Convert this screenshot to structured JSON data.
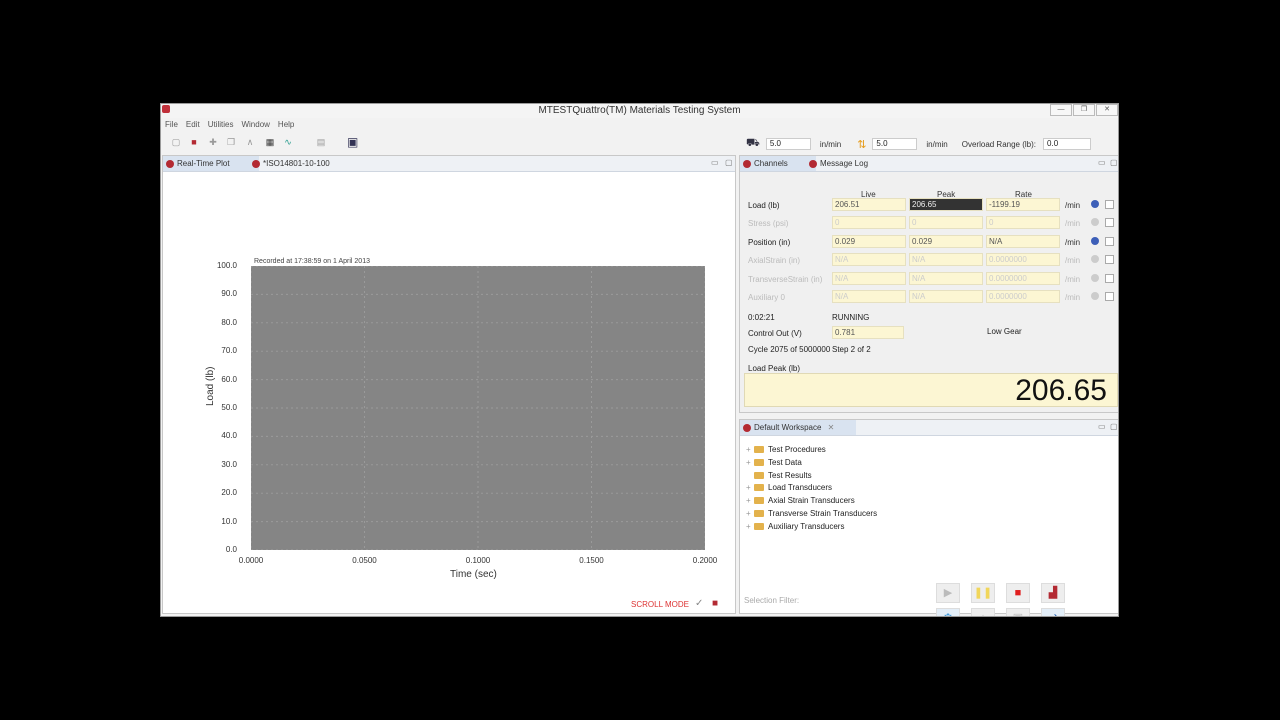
{
  "window": {
    "title": "MTESTQuattro(TM) Materials Testing System",
    "controls": [
      "—",
      "❐",
      "✕"
    ]
  },
  "menu": [
    "File",
    "Edit",
    "Utilities",
    "Window",
    "Help"
  ],
  "speed": {
    "value1": "5.0",
    "unit1": "in/min",
    "value2": "5.0",
    "unit2": "in/min",
    "overload_label": "Overload Range (lb):",
    "overload_value": "0.0"
  },
  "plot_tabs": [
    "Real-Time Plot",
    "*ISO14801-10-100"
  ],
  "chart_data": {
    "type": "line",
    "title": "Recorded at 17:38:59 on 1 April 2013",
    "xlabel": "Time (sec)",
    "ylabel": "Load (lb)",
    "xlim": [
      0.0,
      0.2
    ],
    "ylim": [
      0.0,
      100.0
    ],
    "x_ticks": [
      "0.0000",
      "0.0500",
      "0.1000",
      "0.1500",
      "0.2000"
    ],
    "y_ticks": [
      "100.0",
      "90.0",
      "80.0",
      "70.0",
      "60.0",
      "50.0",
      "40.0",
      "30.0",
      "20.0",
      "10.0",
      "0.0"
    ],
    "grid": true,
    "series": []
  },
  "scroll_mode": "SCROLL MODE",
  "channel_tabs": [
    "Channels",
    "Message Log"
  ],
  "channels": {
    "headers": [
      "Live",
      "Peak",
      "Rate"
    ],
    "rows": [
      {
        "name": "Load (lb)",
        "live": "206.51",
        "peak": "206.65",
        "rate": "-1199.19",
        "unit": "/min",
        "enabled": true
      },
      {
        "name": "Stress (psi)",
        "live": "0",
        "peak": "0",
        "rate": "0",
        "unit": "/min",
        "enabled": false
      },
      {
        "name": "Position (in)",
        "live": "0.029",
        "peak": "0.029",
        "rate": "N/A",
        "unit": "/min",
        "enabled": true
      },
      {
        "name": "AxialStrain (in)",
        "live": "N/A",
        "peak": "N/A",
        "rate": "0.0000000",
        "unit": "/min",
        "enabled": false
      },
      {
        "name": "TransverseStrain (in)",
        "live": "N/A",
        "peak": "N/A",
        "rate": "0.0000000",
        "unit": "/min",
        "enabled": false
      },
      {
        "name": "Auxiliary 0",
        "live": "N/A",
        "peak": "N/A",
        "rate": "0.0000000",
        "unit": "/min",
        "enabled": false
      }
    ],
    "elapsed": "0:02:21",
    "status": "RUNNING",
    "control_label": "Control Out (V)",
    "control_value": "0.781",
    "gear": "Low Gear",
    "cycle": "Cycle 2075 of 5000000",
    "step": "Step 2 of 2",
    "peak_label": "Load Peak (lb)",
    "peak_value": "206.65"
  },
  "workspace": {
    "title": "Default Workspace",
    "items": [
      "Test Procedures",
      "Test Data",
      "Test Results",
      "Load Transducers",
      "Axial Strain Transducers",
      "Transverse Strain Transducers",
      "Auxiliary Transducers"
    ],
    "filter_label": "Selection Filter:"
  },
  "colors": {
    "plot_bg": "#858585",
    "cell_bg": "#fcf6d3",
    "scroll_mode": "#dd3333",
    "stop": "#e01e1e"
  }
}
